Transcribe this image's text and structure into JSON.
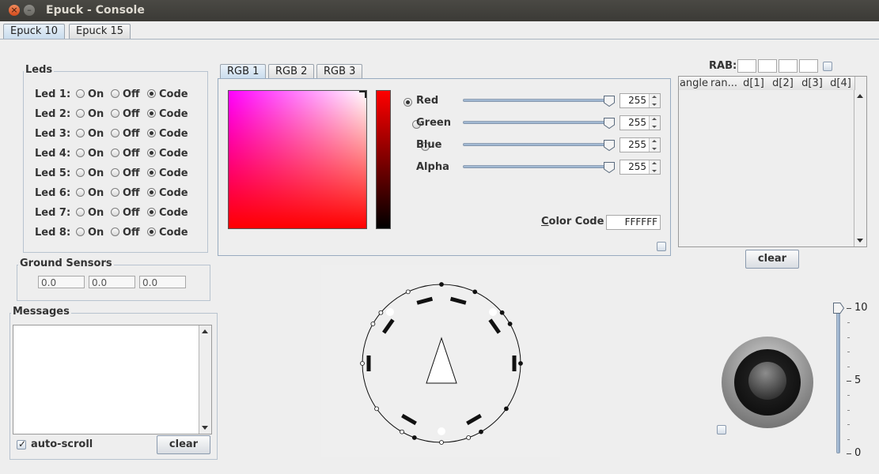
{
  "window": {
    "title": "Epuck - Console",
    "close_glyph": "×",
    "min_glyph": "–"
  },
  "tabs": [
    "Epuck 10",
    "Epuck 15"
  ],
  "leds": {
    "title": "Leds",
    "options": [
      "On",
      "Off",
      "Code"
    ],
    "rows": [
      {
        "label": "Led 1:",
        "selected": "Code"
      },
      {
        "label": "Led 2:",
        "selected": "Code"
      },
      {
        "label": "Led 3:",
        "selected": "Code"
      },
      {
        "label": "Led 4:",
        "selected": "Code"
      },
      {
        "label": "Led 5:",
        "selected": "Code"
      },
      {
        "label": "Led 6:",
        "selected": "Code"
      },
      {
        "label": "Led 7:",
        "selected": "Code"
      },
      {
        "label": "Led 8:",
        "selected": "Code"
      }
    ]
  },
  "ground": {
    "title": "Ground Sensors",
    "values": [
      "0.0",
      "0.0",
      "0.0"
    ]
  },
  "messages": {
    "title": "Messages",
    "autoscroll_label": "auto-scroll",
    "autoscroll_checked": true,
    "clear_label": "clear"
  },
  "color": {
    "tabs": [
      "RGB 1",
      "RGB 2",
      "RGB 3"
    ],
    "channels": [
      {
        "label": "Red",
        "value": "255",
        "radio": true,
        "selected": true
      },
      {
        "label": "Green",
        "value": "255",
        "radio": true,
        "selected": false
      },
      {
        "label": "Blue",
        "value": "255",
        "radio": true,
        "selected": false
      },
      {
        "label": "Alpha",
        "value": "255",
        "radio": false,
        "selected": false
      }
    ],
    "color_code_label_first": "C",
    "color_code_label_rest": "olor Code",
    "color_code_value": "FFFFFF"
  },
  "rab": {
    "label": "RAB:",
    "columns": [
      "angle",
      "ran...",
      "d[1]",
      "d[2]",
      "d[3]",
      "d[4]"
    ],
    "clear_label": "clear"
  },
  "speed_slider": {
    "ticks": [
      "10",
      "5",
      "0"
    ],
    "value": 10
  }
}
